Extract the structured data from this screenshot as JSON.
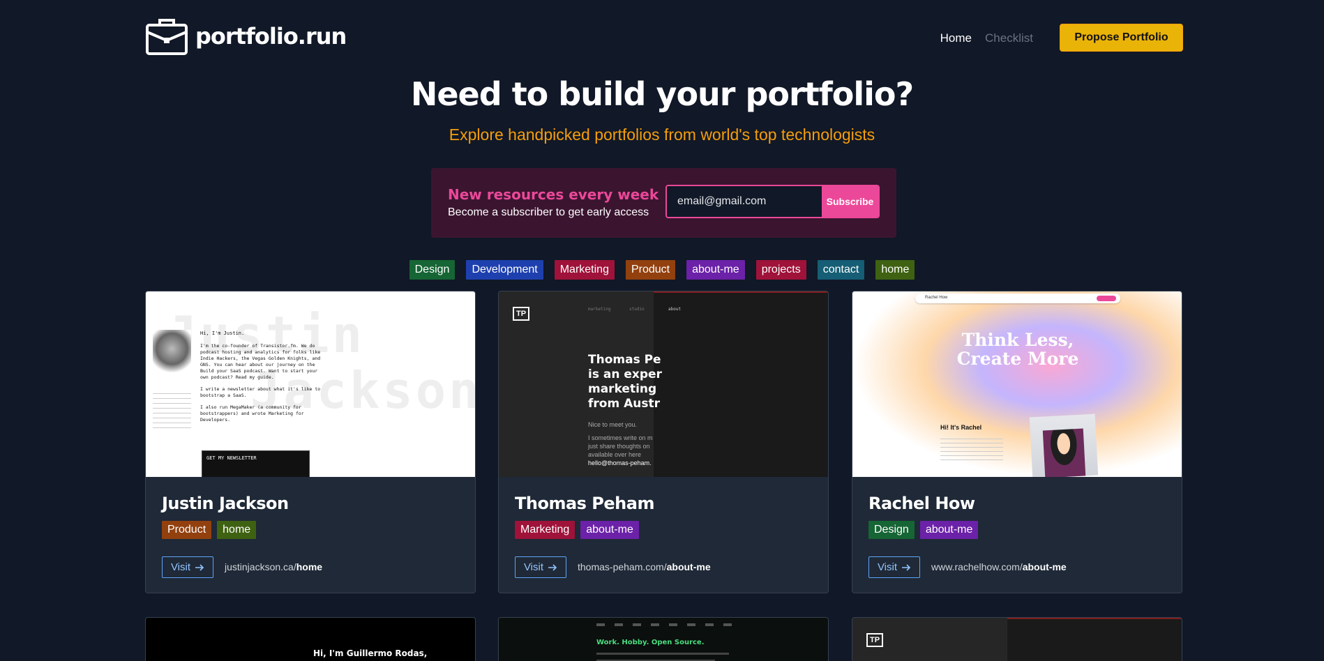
{
  "header": {
    "logo_text": "portfolio.run",
    "nav_home": "Home",
    "nav_checklist": "Checklist",
    "propose_button": "Propose Portfolio"
  },
  "hero": {
    "title": "Need to build your portfolio?",
    "subtitle": "Explore handpicked portfolios from world's top technologists"
  },
  "newsletter": {
    "title": "New resources every week",
    "subtitle": "Become a subscriber to get early access",
    "email_placeholder": "email@gmail.com",
    "subscribe_label": "Subscribe"
  },
  "filters": [
    "Design",
    "Development",
    "Marketing",
    "Product",
    "about-me",
    "projects",
    "contact",
    "home"
  ],
  "cards": [
    {
      "name": "Justin Jackson",
      "tags": [
        "Product",
        "home"
      ],
      "visit_label": "Visit",
      "url_domain": "justinjackson.ca/",
      "url_path": "home",
      "shot": {
        "bg_text_1": "Justin",
        "bg_text_2": "Jackson",
        "greeting": "Hi, I'm Justin.",
        "line1": "I'm the co-founder of Transistor.fm. We do",
        "line2": "podcast hosting and analytics for folks like",
        "line3": "Indie Hackers, the Vegas Golden Knights, and",
        "line4": "GNS. You can hear about our journey on the",
        "line5": "Build your SaaS podcast. Want to start your",
        "line6": "own podcast? Read my guide.",
        "line7": "I write a newsletter about what it's like to",
        "line8": "bootstrap a SaaS.",
        "line9": "I also run MegaMaker (a community for",
        "line10": "bootstrappers) and wrote Marketing for",
        "line11": "Developers.",
        "newsletter_box": "GET MY NEWSLETTER"
      }
    },
    {
      "name": "Thomas Peham",
      "tags": [
        "Marketing",
        "about-me"
      ],
      "visit_label": "Visit",
      "url_domain": "thomas-peham.com/",
      "url_path": "about-me",
      "shot": {
        "logo": "TP",
        "nav1": "marketing",
        "nav2": "studio",
        "nav3": "about",
        "headline1": "Thomas Pe",
        "headline2": "is an exper",
        "headline3": "marketing",
        "headline4": "from Austr",
        "nice": "Nice to meet you.",
        "body1": "I sometimes write on m",
        "body2": "just share thoughts on",
        "body3": "available over here",
        "body4": "hello@thomas-peham."
      }
    },
    {
      "name": "Rachel How",
      "tags": [
        "Design",
        "about-me"
      ],
      "visit_label": "Visit",
      "url_domain": "www.rachelhow.com/",
      "url_path": "about-me",
      "shot": {
        "brand": "Rachel How",
        "headline1": "Think Less,",
        "headline2": "Create More",
        "greeting": "Hi! It's Rachel"
      }
    }
  ],
  "bottom_cards": [
    {
      "text": "Hi, I'm Guillermo Rodas,"
    },
    {
      "text": "Work. Hobby. Open Source."
    },
    {
      "text": "TP"
    }
  ]
}
